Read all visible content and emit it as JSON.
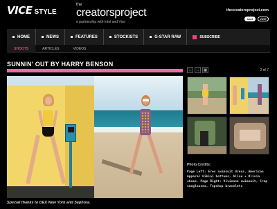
{
  "header": {
    "vice_logo": "VICE",
    "style_word": "STYLE",
    "creators_the": "the",
    "creators_title": "creatorsproject",
    "partnership": "a partnership with Intel and Vice",
    "site_url": "thecreatorsproject.com",
    "partner_logos": [
      "intel",
      "VICE"
    ]
  },
  "main_nav": {
    "items": [
      {
        "label": "HOME"
      },
      {
        "label": "NEWS"
      },
      {
        "label": "FEATURES"
      },
      {
        "label": "STOCKISTS"
      },
      {
        "label": "G-STAR RAW"
      }
    ],
    "subscribe": "SUBSCRIBE",
    "accent_color": "#e8447f"
  },
  "sub_nav": {
    "items": [
      {
        "label": "SHOOTS",
        "active": true
      },
      {
        "label": "ARTICLES",
        "active": false
      },
      {
        "label": "VIDEOS",
        "active": false
      }
    ]
  },
  "article": {
    "title": "SUNNIN' OUT BY HARRY BENSON",
    "bar_color": "#e86fa6",
    "credit_line": "Special thanks to DEX New York and Sephora."
  },
  "gallery": {
    "prev_icon": "←",
    "next_icon": "→",
    "grid_icon": "▦",
    "page_count": "2 of 7"
  },
  "photo_credits": {
    "label": "Photo Credits:",
    "text": "Page Left: Eres swimsuit dress, American Apparel bikini bottoms, Alice + Olivia shoes. Page Right: Vivienne swimsuit, Crap sunglasses, Topshop bracelets"
  }
}
